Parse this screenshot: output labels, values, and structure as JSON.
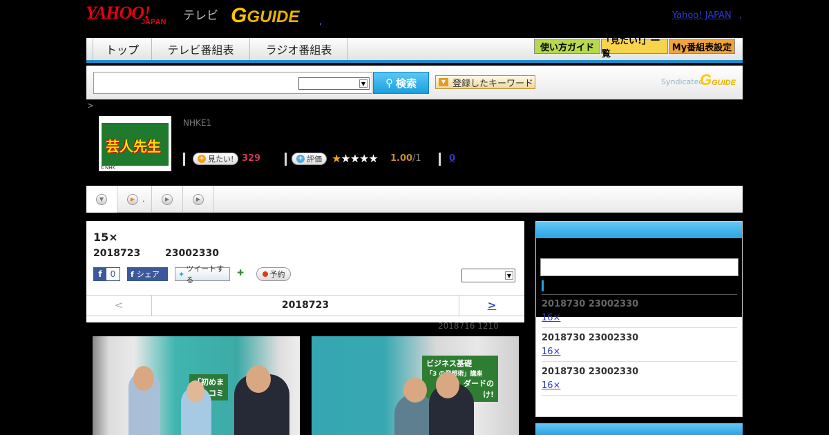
{
  "header": {
    "logo_yahoo": "YAHOO!",
    "logo_japan": "JAPAN",
    "logo_tv": "テレビ",
    "logo_gguide": "GUIDE",
    "dot": ",",
    "yahoo_japan_link": "Yahoo! JAPAN",
    "yahoo_japan_dot": ","
  },
  "nav": {
    "tabs": [
      "トップ",
      "テレビ番組表",
      "ラジオ番組表"
    ],
    "buttons": [
      {
        "label": "使い方ガイド",
        "color": "#b6d94e"
      },
      {
        "label": "「見たい!」一覧",
        "color": "#f7d44b"
      },
      {
        "label": "My番組表設定",
        "color": "#f0a43a"
      }
    ]
  },
  "search": {
    "input_value": "",
    "select_value": "",
    "button_label": "検索",
    "keyword_button": "登録したキーワード",
    "syndicated": "Syndicated",
    "syndicated_logo": "GUIDE"
  },
  "breadcrumb": ">",
  "program": {
    "thumb_title": "芸人先生",
    "thumb_credit": "©NHK",
    "channel": "NHKE1",
    "want_label": "見たい!",
    "want_count": "329",
    "rate_label": "評価",
    "stars_on": 1,
    "stars_total": 5,
    "rating": "1.00",
    "rating_sub": "/1",
    "review_count": "0"
  },
  "tabs": [
    {
      "icon": "chevron-down",
      "label": ""
    },
    {
      "icon": "play",
      "label": "."
    },
    {
      "icon": "play",
      "label": ""
    },
    {
      "icon": "play",
      "label": ""
    }
  ],
  "episode": {
    "title": "15×",
    "date": "2018723",
    "time": "23002330",
    "fb_count": "0",
    "share_label": "シェア",
    "tweet_label": "ツイートする",
    "reserve_label": "予約",
    "select_value": "",
    "pager_prev": "<",
    "pager_date": "2018723",
    "pager_next": ">",
    "update_note": "2018716  1210"
  },
  "sidebar": {
    "input_value": "",
    "items": [
      {
        "date": "2018730  23002330",
        "link": "16×"
      },
      {
        "date": "2018730  23002330",
        "link": "16×"
      },
      {
        "date": "2018730  23002330",
        "link": "16×"
      }
    ]
  },
  "photos": {
    "sign1_line1": "「初めま",
    "sign1_line2": "ツッコミ",
    "sign2_line1": "ビジネス基礎",
    "sign2_line2": "「3 の発想術」講座",
    "sign2_line3": "ダードの",
    "sign2_line4": "け!"
  }
}
